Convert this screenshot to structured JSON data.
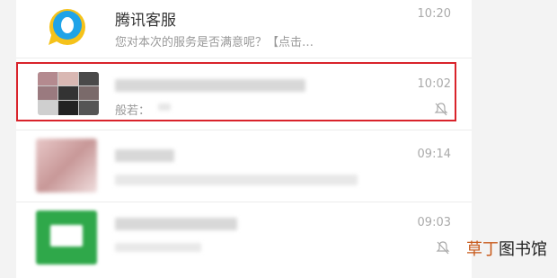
{
  "chats": [
    {
      "name": "腾讯客服",
      "preview": "您对本次的服务是否满意呢？【点击…",
      "time": "10:20",
      "avatar_icon": "qq-penguin-icon"
    },
    {
      "name": "",
      "preview": "般若：",
      "time": "10:02",
      "avatar_icon": "group-grid-avatar",
      "muted": true
    },
    {
      "name": "",
      "preview": "",
      "time": "09:14",
      "avatar_icon": "blurred-avatar"
    },
    {
      "name": "",
      "preview": "",
      "time": "09:03",
      "avatar_icon": "blurred-green-avatar",
      "muted": true
    }
  ],
  "watermark": {
    "accent": "草丁",
    "rest": "图书馆"
  },
  "colors": {
    "highlight": "#d9232b",
    "qq_blue": "#1fa3e8",
    "qq_yellow": "#f5c21a"
  }
}
